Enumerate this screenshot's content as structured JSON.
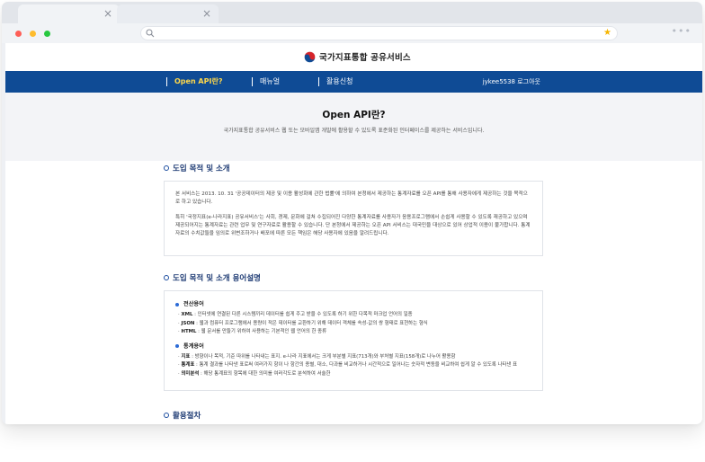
{
  "browser": {
    "tab_close_glyph": "×",
    "star_glyph": "★",
    "menu_glyph": "•••"
  },
  "site": {
    "logo_text": "국가지표통합 공유서비스",
    "nav": [
      {
        "label": "Open API란?",
        "active": true
      },
      {
        "label": "매뉴얼",
        "active": false
      },
      {
        "label": "활용신청",
        "active": false
      }
    ],
    "user_label": "jykee5538 로그아웃"
  },
  "hero": {
    "title": "Open API란?",
    "subtitle": "국가지표통합 공유서비스 웹 또는 모바일앱 개발에 활용할 수 있도록 표준화된 인터페이스를 제공하는 서비스입니다."
  },
  "sections": {
    "intro": {
      "title": "도입 목적 및 소개",
      "paragraphs": [
        "본 서비스는 2013. 10. 31 '공공데이터의 제공 및 이용 활성화에 관한 법률'에 의하여 본청에서 제공하는 통계자료를 오픈 API를 통해 사용자에게 제공하는 것을 목적으로 하고 있습니다.",
        "특히 '국정지표(e-나라지표) 공유서비스'는 사회, 경제, 문화에 걸쳐 수집되어진 다양한 통계자료를 사용자가 응용프로그램에서 손쉽게 사용할 수 있도록 재공하고 있으며 제공되어지는 통계자료는 관련 업무 및 연구자료로 활용할 수 있습니다. 단 본청에서 제공하는 오픈 API 서비스는 대국민을 대상으로 있어 상업적 이용이 불가합니다. 통계자료의 수치값들을 임의로 위변조하거나 배포에 따른 모든 책임은 해당 사용자에 있음을 알려드립니다."
      ]
    },
    "terms": {
      "title": "도입 목적 및 소개 용어설명",
      "groups": [
        {
          "title": "전산용어",
          "items": [
            {
              "term": "XML",
              "desc": " : 인터넷에 연결된 다른 시스템끼리 데이터를 쉽게 주고 받을 수 있도록 하기 위한 다목적 마크업 언어의 일종"
            },
            {
              "term": "JSON",
              "desc": " : 웹과 컴퓨터 프로그램에서 용량이 적은 데이터를 교환하기 위해 데이터 객체를 속성-값의 쌍 형태로 표현하는 형식"
            },
            {
              "term": "HTML",
              "desc": " : 웹 문서를 만들기 위하여 사용하는 기본적인 웹 언어의 한 종류"
            }
          ]
        },
        {
          "title": "통계용어",
          "items": [
            {
              "term": "지표",
              "desc": " : 방향이나 목적, 기준 따위를 나타내는 표지. e-나라 지표에서는 크게 부분별 지표(713개)와 부처별 지표(158개)로 나누어 활용함"
            },
            {
              "term": "통계표",
              "desc": " : 통계 결과를 나타낸 표로써 여러가지 항이 나 항간의 종별, 대소, 다과를 비교하거나 시간적으로 일어나는 숫자적 변동을 비교하여 쉽게 알 수 있도록 나타낸 표"
            },
            {
              "term": "의미분석",
              "desc": " : 해당 통계표의 항목에 대한 의미를 여러각도로 분석하여 서술한"
            }
          ]
        }
      ]
    },
    "usage": {
      "title": "활용절차"
    }
  },
  "colors": {
    "nav_bg": "#0f4b95",
    "nav_active": "#ffd84a",
    "section_title": "#1d3a73",
    "bullet": "#2c6bd6"
  }
}
